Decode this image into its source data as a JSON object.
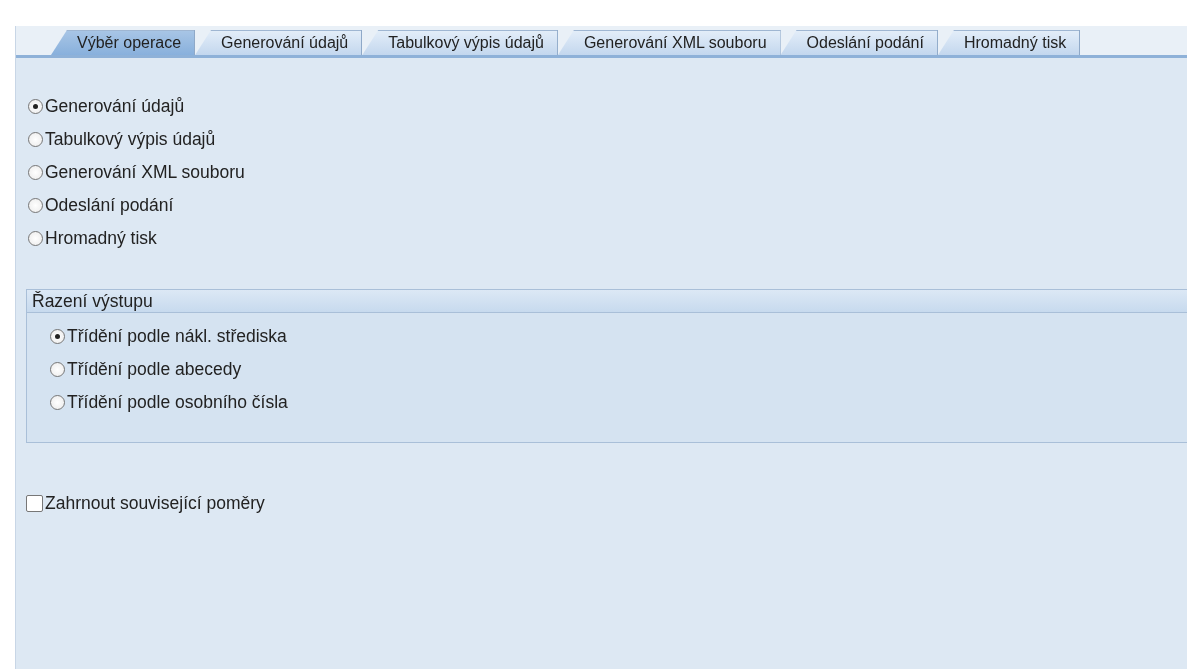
{
  "tabs": [
    {
      "label": "Výběr operace",
      "selected": true
    },
    {
      "label": "Generování údajů",
      "selected": false
    },
    {
      "label": "Tabulkový výpis údajů",
      "selected": false
    },
    {
      "label": "Generování XML souboru",
      "selected": false
    },
    {
      "label": "Odeslání podání",
      "selected": false
    },
    {
      "label": "Hromadný tisk",
      "selected": false
    }
  ],
  "operations": [
    {
      "label": "Generování údajů",
      "selected": true
    },
    {
      "label": "Tabulkový výpis údajů",
      "selected": false
    },
    {
      "label": "Generování XML souboru",
      "selected": false
    },
    {
      "label": "Odeslání podání",
      "selected": false
    },
    {
      "label": "Hromadný tisk",
      "selected": false
    }
  ],
  "output_sorting": {
    "title": "Řazení výstupu",
    "options": [
      {
        "label": "Třídění podle nákl. střediska",
        "selected": true
      },
      {
        "label": "Třídění podle abecedy",
        "selected": false
      },
      {
        "label": "Třídění podle osobního čísla",
        "selected": false
      }
    ]
  },
  "include_related": {
    "label": "Zahrnout související poměry",
    "checked": false
  }
}
